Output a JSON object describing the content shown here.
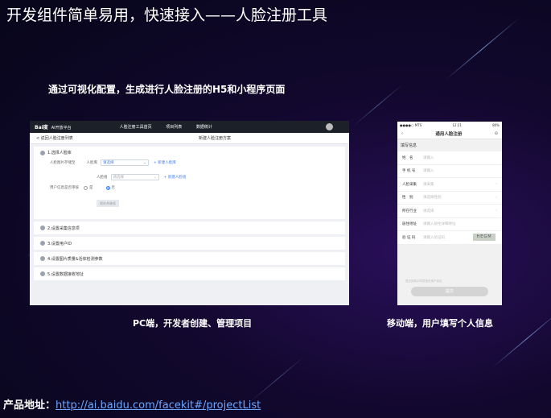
{
  "title": "开发组件简单易用，快速接入——人脸注册工具",
  "subtitle": "通过可视化配置，生成进行人脸注册的H5和小程序页面",
  "pc": {
    "logo": "Bai度",
    "logo_sub": "AI开放平台",
    "nav": [
      "人脸注册工具首页",
      "项目列表",
      "数据统计"
    ],
    "back": "< 返回人脸注册列表",
    "page_title": "新建人脸注册方案",
    "step1": "1.选择人脸库",
    "face_source_label": "人脸图片存储至",
    "lib_label": "人脸库",
    "lib_value": "请选择",
    "add_lib": "+ 新建人脸库",
    "group_label": "人脸组",
    "group_value": "请选择",
    "add_group": "+ 新建人脸组",
    "dedup_label": "用户信息是否审核",
    "yes": "是",
    "no": "否",
    "save_btn": "保存并继续",
    "steps": [
      "2.设置采集信息项",
      "3.设置用户ID",
      "4.设置图片质量&活体检测参数",
      "5.设置数据接收地址"
    ]
  },
  "mobile": {
    "status_left": "●●●●○ MTS",
    "status_time": "12:21",
    "status_right": "80%",
    "header": "通用人脸注册",
    "section": "填写信息",
    "fields": [
      {
        "label": "姓　名",
        "placeholder": "请输入"
      },
      {
        "label": "手 机 号",
        "placeholder": "请输入"
      },
      {
        "label": "人脸采集",
        "placeholder": "请采集"
      },
      {
        "label": "性　别",
        "placeholder": "请选择性别"
      },
      {
        "label": "所在行业",
        "placeholder": "请选择"
      },
      {
        "label": "居住地址",
        "placeholder": "请输入居住详细地址"
      },
      {
        "label": "验 证 码",
        "placeholder": "请输入验证码"
      }
    ],
    "captcha": "HEGM",
    "note": "提交即表示同意相关用户协议",
    "submit": "提交"
  },
  "caption_pc": "PC端，开发者创建、管理项目",
  "caption_mobile": "移动端，用户填写个人信息",
  "footer_label": "产品地址：",
  "footer_link": "http://ai.baidu.com/facekit#/projectList"
}
